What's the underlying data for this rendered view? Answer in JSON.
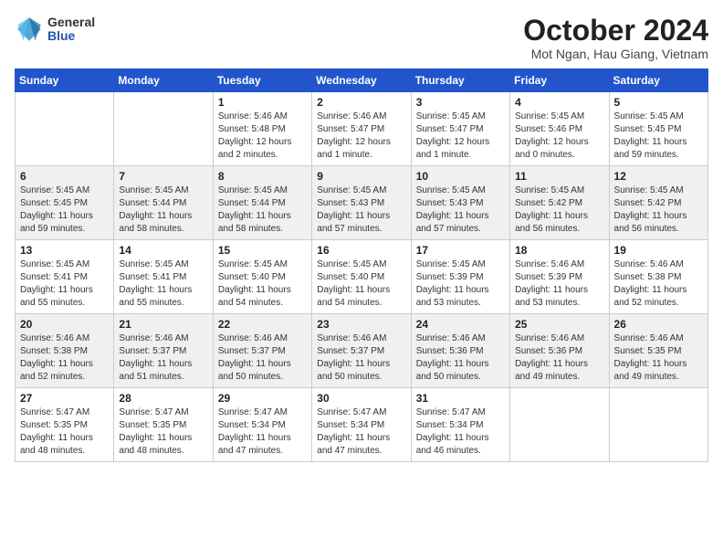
{
  "header": {
    "logo_general": "General",
    "logo_blue": "Blue",
    "title": "October 2024",
    "location": "Mot Ngan, Hau Giang, Vietnam"
  },
  "days_of_week": [
    "Sunday",
    "Monday",
    "Tuesday",
    "Wednesday",
    "Thursday",
    "Friday",
    "Saturday"
  ],
  "weeks": [
    [
      {
        "day": "",
        "info": ""
      },
      {
        "day": "",
        "info": ""
      },
      {
        "day": "1",
        "info": "Sunrise: 5:46 AM\nSunset: 5:48 PM\nDaylight: 12 hours\nand 2 minutes."
      },
      {
        "day": "2",
        "info": "Sunrise: 5:46 AM\nSunset: 5:47 PM\nDaylight: 12 hours\nand 1 minute."
      },
      {
        "day": "3",
        "info": "Sunrise: 5:45 AM\nSunset: 5:47 PM\nDaylight: 12 hours\nand 1 minute."
      },
      {
        "day": "4",
        "info": "Sunrise: 5:45 AM\nSunset: 5:46 PM\nDaylight: 12 hours\nand 0 minutes."
      },
      {
        "day": "5",
        "info": "Sunrise: 5:45 AM\nSunset: 5:45 PM\nDaylight: 11 hours\nand 59 minutes."
      }
    ],
    [
      {
        "day": "6",
        "info": "Sunrise: 5:45 AM\nSunset: 5:45 PM\nDaylight: 11 hours\nand 59 minutes."
      },
      {
        "day": "7",
        "info": "Sunrise: 5:45 AM\nSunset: 5:44 PM\nDaylight: 11 hours\nand 58 minutes."
      },
      {
        "day": "8",
        "info": "Sunrise: 5:45 AM\nSunset: 5:44 PM\nDaylight: 11 hours\nand 58 minutes."
      },
      {
        "day": "9",
        "info": "Sunrise: 5:45 AM\nSunset: 5:43 PM\nDaylight: 11 hours\nand 57 minutes."
      },
      {
        "day": "10",
        "info": "Sunrise: 5:45 AM\nSunset: 5:43 PM\nDaylight: 11 hours\nand 57 minutes."
      },
      {
        "day": "11",
        "info": "Sunrise: 5:45 AM\nSunset: 5:42 PM\nDaylight: 11 hours\nand 56 minutes."
      },
      {
        "day": "12",
        "info": "Sunrise: 5:45 AM\nSunset: 5:42 PM\nDaylight: 11 hours\nand 56 minutes."
      }
    ],
    [
      {
        "day": "13",
        "info": "Sunrise: 5:45 AM\nSunset: 5:41 PM\nDaylight: 11 hours\nand 55 minutes."
      },
      {
        "day": "14",
        "info": "Sunrise: 5:45 AM\nSunset: 5:41 PM\nDaylight: 11 hours\nand 55 minutes."
      },
      {
        "day": "15",
        "info": "Sunrise: 5:45 AM\nSunset: 5:40 PM\nDaylight: 11 hours\nand 54 minutes."
      },
      {
        "day": "16",
        "info": "Sunrise: 5:45 AM\nSunset: 5:40 PM\nDaylight: 11 hours\nand 54 minutes."
      },
      {
        "day": "17",
        "info": "Sunrise: 5:45 AM\nSunset: 5:39 PM\nDaylight: 11 hours\nand 53 minutes."
      },
      {
        "day": "18",
        "info": "Sunrise: 5:46 AM\nSunset: 5:39 PM\nDaylight: 11 hours\nand 53 minutes."
      },
      {
        "day": "19",
        "info": "Sunrise: 5:46 AM\nSunset: 5:38 PM\nDaylight: 11 hours\nand 52 minutes."
      }
    ],
    [
      {
        "day": "20",
        "info": "Sunrise: 5:46 AM\nSunset: 5:38 PM\nDaylight: 11 hours\nand 52 minutes."
      },
      {
        "day": "21",
        "info": "Sunrise: 5:46 AM\nSunset: 5:37 PM\nDaylight: 11 hours\nand 51 minutes."
      },
      {
        "day": "22",
        "info": "Sunrise: 5:46 AM\nSunset: 5:37 PM\nDaylight: 11 hours\nand 50 minutes."
      },
      {
        "day": "23",
        "info": "Sunrise: 5:46 AM\nSunset: 5:37 PM\nDaylight: 11 hours\nand 50 minutes."
      },
      {
        "day": "24",
        "info": "Sunrise: 5:46 AM\nSunset: 5:36 PM\nDaylight: 11 hours\nand 50 minutes."
      },
      {
        "day": "25",
        "info": "Sunrise: 5:46 AM\nSunset: 5:36 PM\nDaylight: 11 hours\nand 49 minutes."
      },
      {
        "day": "26",
        "info": "Sunrise: 5:46 AM\nSunset: 5:35 PM\nDaylight: 11 hours\nand 49 minutes."
      }
    ],
    [
      {
        "day": "27",
        "info": "Sunrise: 5:47 AM\nSunset: 5:35 PM\nDaylight: 11 hours\nand 48 minutes."
      },
      {
        "day": "28",
        "info": "Sunrise: 5:47 AM\nSunset: 5:35 PM\nDaylight: 11 hours\nand 48 minutes."
      },
      {
        "day": "29",
        "info": "Sunrise: 5:47 AM\nSunset: 5:34 PM\nDaylight: 11 hours\nand 47 minutes."
      },
      {
        "day": "30",
        "info": "Sunrise: 5:47 AM\nSunset: 5:34 PM\nDaylight: 11 hours\nand 47 minutes."
      },
      {
        "day": "31",
        "info": "Sunrise: 5:47 AM\nSunset: 5:34 PM\nDaylight: 11 hours\nand 46 minutes."
      },
      {
        "day": "",
        "info": ""
      },
      {
        "day": "",
        "info": ""
      }
    ]
  ]
}
